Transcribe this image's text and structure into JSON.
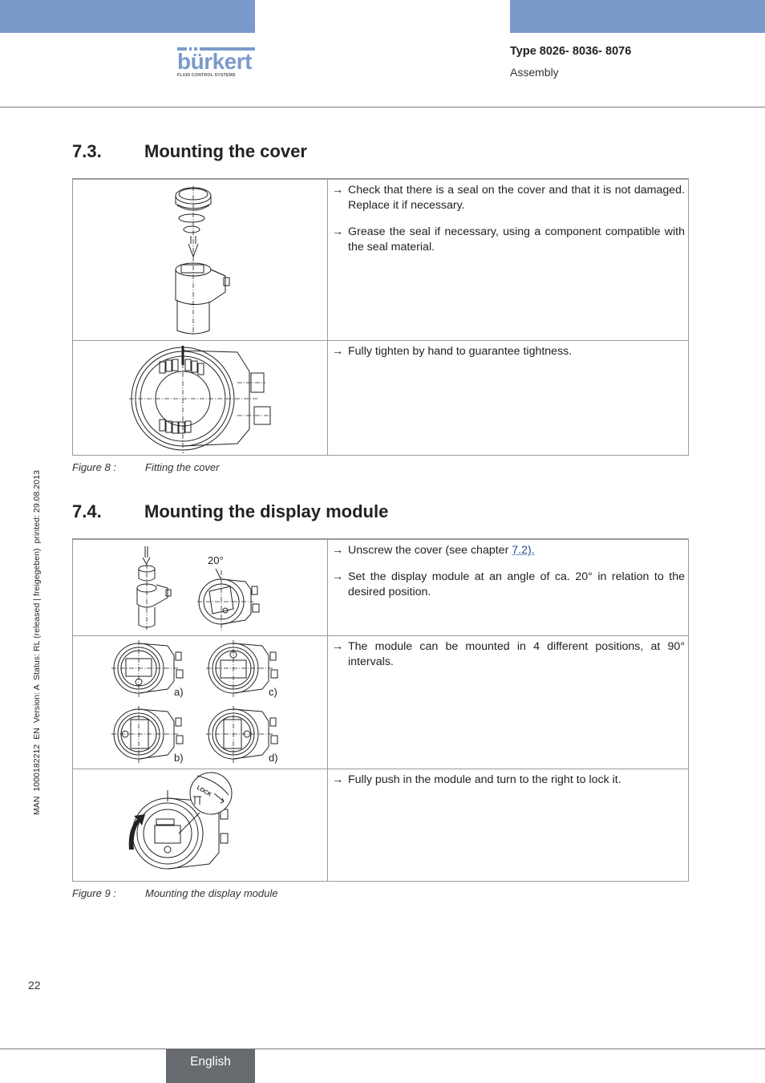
{
  "header": {
    "logo": {
      "brand": "bürkert",
      "tagline": "FLUID CONTROL SYSTEMS"
    },
    "doc_type": "Type 8026- 8036- 8076",
    "doc_section": "Assembly",
    "band_color": "#7a9acb"
  },
  "sidebar_meta": "MAN  1000182212  EN  Version: A  Status: RL (released | freigegeben)  printed: 29.08.2013",
  "sections": [
    {
      "number": "7.3.",
      "title": "Mounting the cover",
      "rows": [
        {
          "image": "cover-exploded-view",
          "steps": [
            {
              "arrow": "→",
              "text": "Check that there is a seal on the cover and that it is not damaged. Replace it if necessary."
            },
            {
              "arrow": "→",
              "text": "Grease the seal if necessary, using a component compatible with the seal material."
            }
          ]
        },
        {
          "image": "cover-top-view",
          "steps": [
            {
              "arrow": "→",
              "text": "Fully tighten by hand to guarantee tightness."
            }
          ]
        }
      ],
      "caption": {
        "label": "Figure 8 :",
        "text": "Fitting the cover"
      }
    },
    {
      "number": "7.4.",
      "title": "Mounting the display module",
      "rows": [
        {
          "image": "display-module-insertion",
          "image_label": "20°",
          "steps": [
            {
              "arrow": "→",
              "text_before": "Unscrew the cover (see chapter ",
              "link": "7.2)",
              "text_after": "."
            },
            {
              "arrow": "→",
              "text": "Set the display module at an angle of ca. 20° in relation to the desired position."
            }
          ]
        },
        {
          "image": "display-module-positions",
          "image_labels": [
            "a)",
            "c)",
            "b)",
            "d)"
          ],
          "steps": [
            {
              "arrow": "→",
              "text": "The module can be mounted in 4 different positions, at 90° intervals."
            }
          ]
        },
        {
          "image": "display-module-lock",
          "image_label": "LOCK",
          "steps": [
            {
              "arrow": "→",
              "text": "Fully push in the module and turn to the right to lock it."
            }
          ]
        }
      ],
      "caption": {
        "label": "Figure 9 :",
        "text": "Mounting the display module"
      }
    }
  ],
  "footer": {
    "page_number": "22",
    "language": "English"
  }
}
